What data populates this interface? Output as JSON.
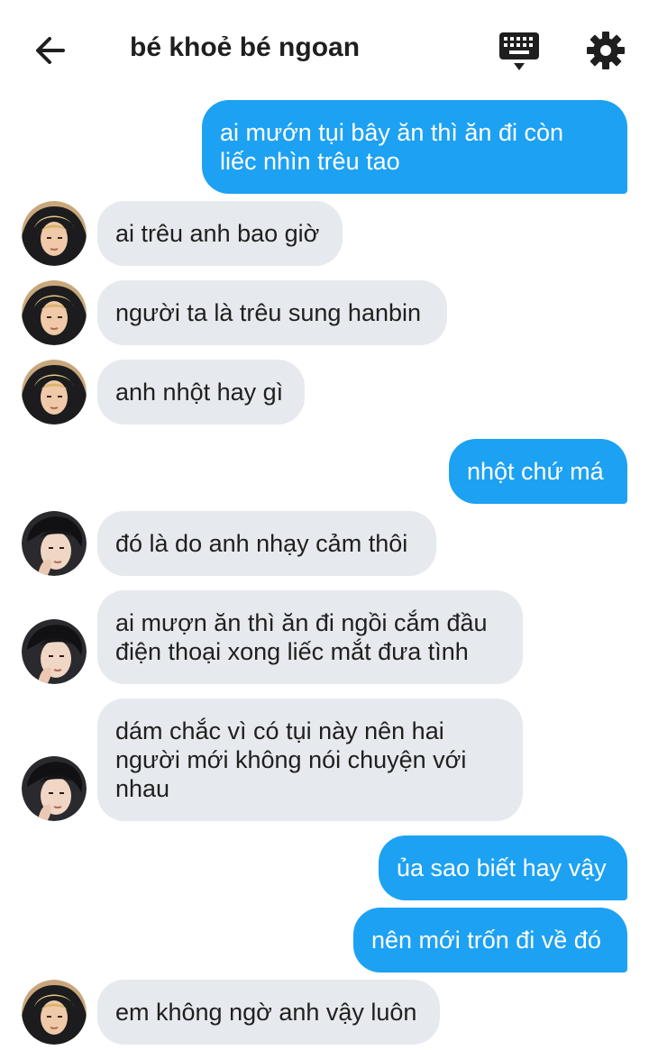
{
  "header": {
    "title": "bé khoẻ bé ngoan",
    "back_icon": "arrow-left-icon",
    "keyboard_icon": "keyboard-icon",
    "settings_icon": "gear-icon"
  },
  "colors": {
    "outgoing_bubble": "#1da1f2",
    "incoming_bubble": "#e6e9ed",
    "text_dark": "#1f1f1f"
  },
  "messages": [
    {
      "direction": "out",
      "text": "ai mướn tụi bây ăn thì ăn đi còn\nliếc nhìn trêu tao"
    },
    {
      "direction": "in",
      "avatar": "avatar-blond",
      "text": "ai trêu anh bao giờ"
    },
    {
      "direction": "in",
      "avatar": "avatar-blond",
      "text": "người ta là trêu sung hanbin"
    },
    {
      "direction": "in",
      "avatar": "avatar-blond",
      "text": "anh nhột hay gì"
    },
    {
      "direction": "out",
      "text": "nhột chứ má"
    },
    {
      "direction": "in",
      "avatar": "avatar-dark",
      "text": "đó là do anh nhạy cảm thôi"
    },
    {
      "direction": "in",
      "avatar": "avatar-dark",
      "text": "ai mượn ăn thì ăn đi ngồi cắm đầu\nđiện thoại xong liếc mắt đưa tình"
    },
    {
      "direction": "in",
      "avatar": "avatar-dark",
      "text": "dám chắc vì có tụi này nên hai\nngười mới không nói chuyện với\nnhau"
    },
    {
      "direction": "out",
      "text": "ủa sao biết hay vậy"
    },
    {
      "direction": "out",
      "text": "nên mới trốn đi về đó"
    },
    {
      "direction": "in",
      "avatar": "avatar-blond",
      "text": "em không ngờ anh vậy luôn"
    }
  ]
}
